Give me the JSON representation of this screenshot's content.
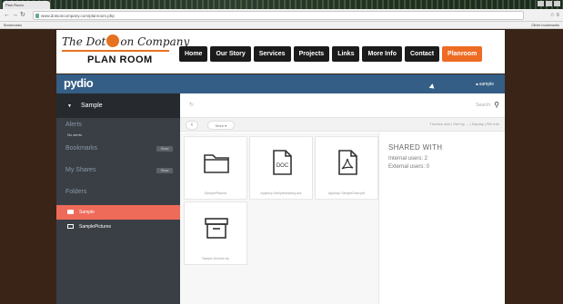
{
  "browser": {
    "tab_title": "Plan Room",
    "url": "www.dotsoncompany.com/planroom.php",
    "bookmarks_left": "Bookmarks",
    "bookmarks_right": "Other bookmarks"
  },
  "site": {
    "logo_script_before": "The Dot",
    "logo_script_after": "on Company",
    "logo_subtitle": "PLAN ROOM",
    "nav": [
      "Home",
      "Our Story",
      "Services",
      "Projects",
      "Links",
      "More Info",
      "Contact",
      "Planroom"
    ],
    "nav_active": "Planroom"
  },
  "app": {
    "logo": "pydio",
    "user_menu": "sample",
    "workspace": "Sample",
    "alerts_label": "Alerts",
    "alerts_note": "No alerts",
    "bookmarks_label": "Bookmarks",
    "bookmarks_pill": "Show",
    "shares_label": "My Shares",
    "shares_pill": "Show",
    "folders_label": "Folders",
    "folders": [
      "Sample",
      "SamplePictures"
    ],
    "search_placeholder": "Search",
    "more_label": "More",
    "view_options": "Thumbs size  |  Sort by ... |  Display  |  File info",
    "files": [
      {
        "name": "SamplePictures",
        "type": "folder"
      },
      {
        "name": "Appliocp Sampledrawing.doc",
        "type": "doc"
      },
      {
        "name": "Appliocp SampleDraw.pdf",
        "type": "pdf"
      },
      {
        "name": "Sample Archive.zip",
        "type": "archive"
      }
    ],
    "info": {
      "title": "SHARED WITH",
      "internal": "Internal users: 2",
      "external": "External users: 0"
    }
  },
  "colors": {
    "accent": "#ee6b23",
    "header_blue": "#345e85",
    "sidebar": "#3a3f45",
    "active_folder": "#ee6b5a"
  }
}
